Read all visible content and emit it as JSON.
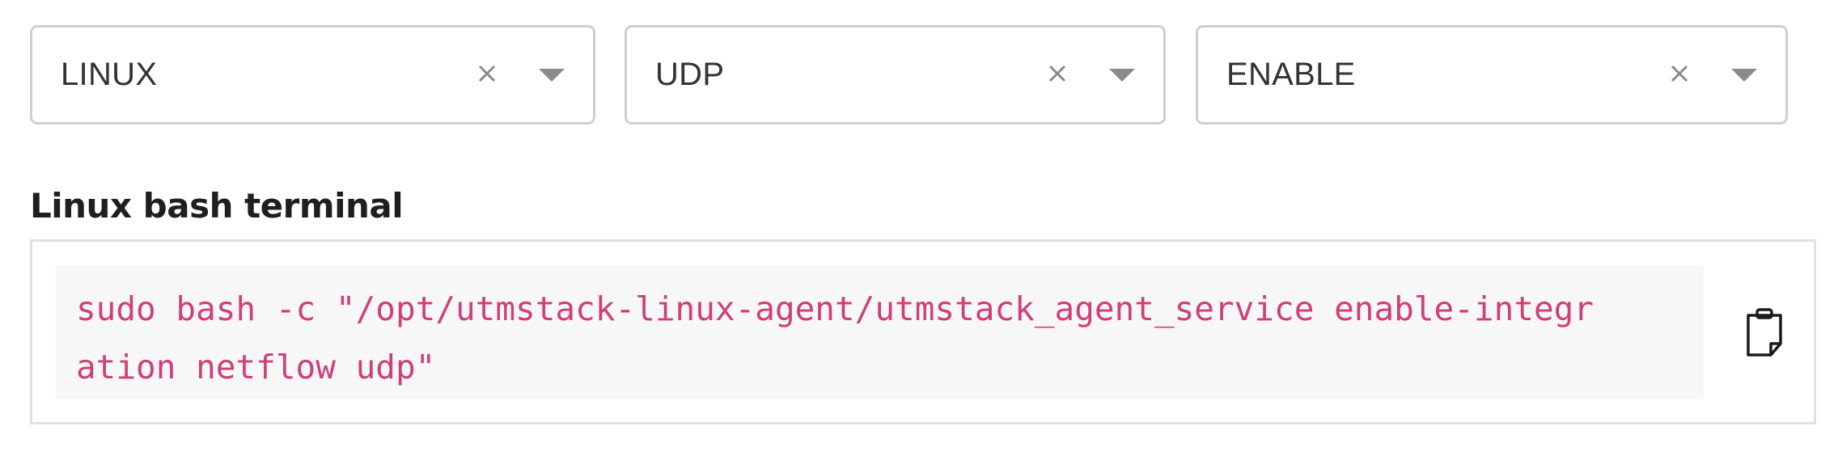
{
  "filters": [
    {
      "value": "LINUX",
      "clear_icon": "close-icon",
      "dropdown_icon": "caret-down-icon"
    },
    {
      "value": "UDP",
      "clear_icon": "close-icon",
      "dropdown_icon": "caret-down-icon"
    },
    {
      "value": "ENABLE",
      "clear_icon": "close-icon",
      "dropdown_icon": "caret-down-icon"
    }
  ],
  "terminal": {
    "title": "Linux bash terminal",
    "command": "sudo bash -c \"/opt/utmstack-linux-agent/utmstack_agent_service enable-integration netflow udp\"",
    "copy_icon": "clipboard-icon"
  },
  "colors": {
    "code_text": "#cf3f78",
    "code_background": "#f7f7f7",
    "border": "#cfcfcf",
    "icon": "#8a8a8a"
  }
}
